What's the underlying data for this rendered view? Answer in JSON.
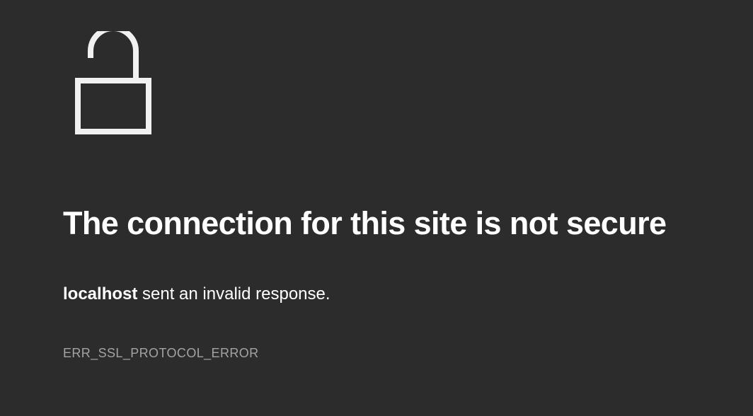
{
  "icon": {
    "name": "lock-open-icon",
    "color": "#f1f1f1"
  },
  "colors": {
    "background": "#2c2c2c",
    "title": "#ffffff",
    "message": "#ffffff",
    "error_code": "#a3a3a3"
  },
  "title": "The connection for this site is not secure",
  "message": {
    "host": "localhost",
    "text": " sent an invalid response."
  },
  "error_code": "ERR_SSL_PROTOCOL_ERROR"
}
